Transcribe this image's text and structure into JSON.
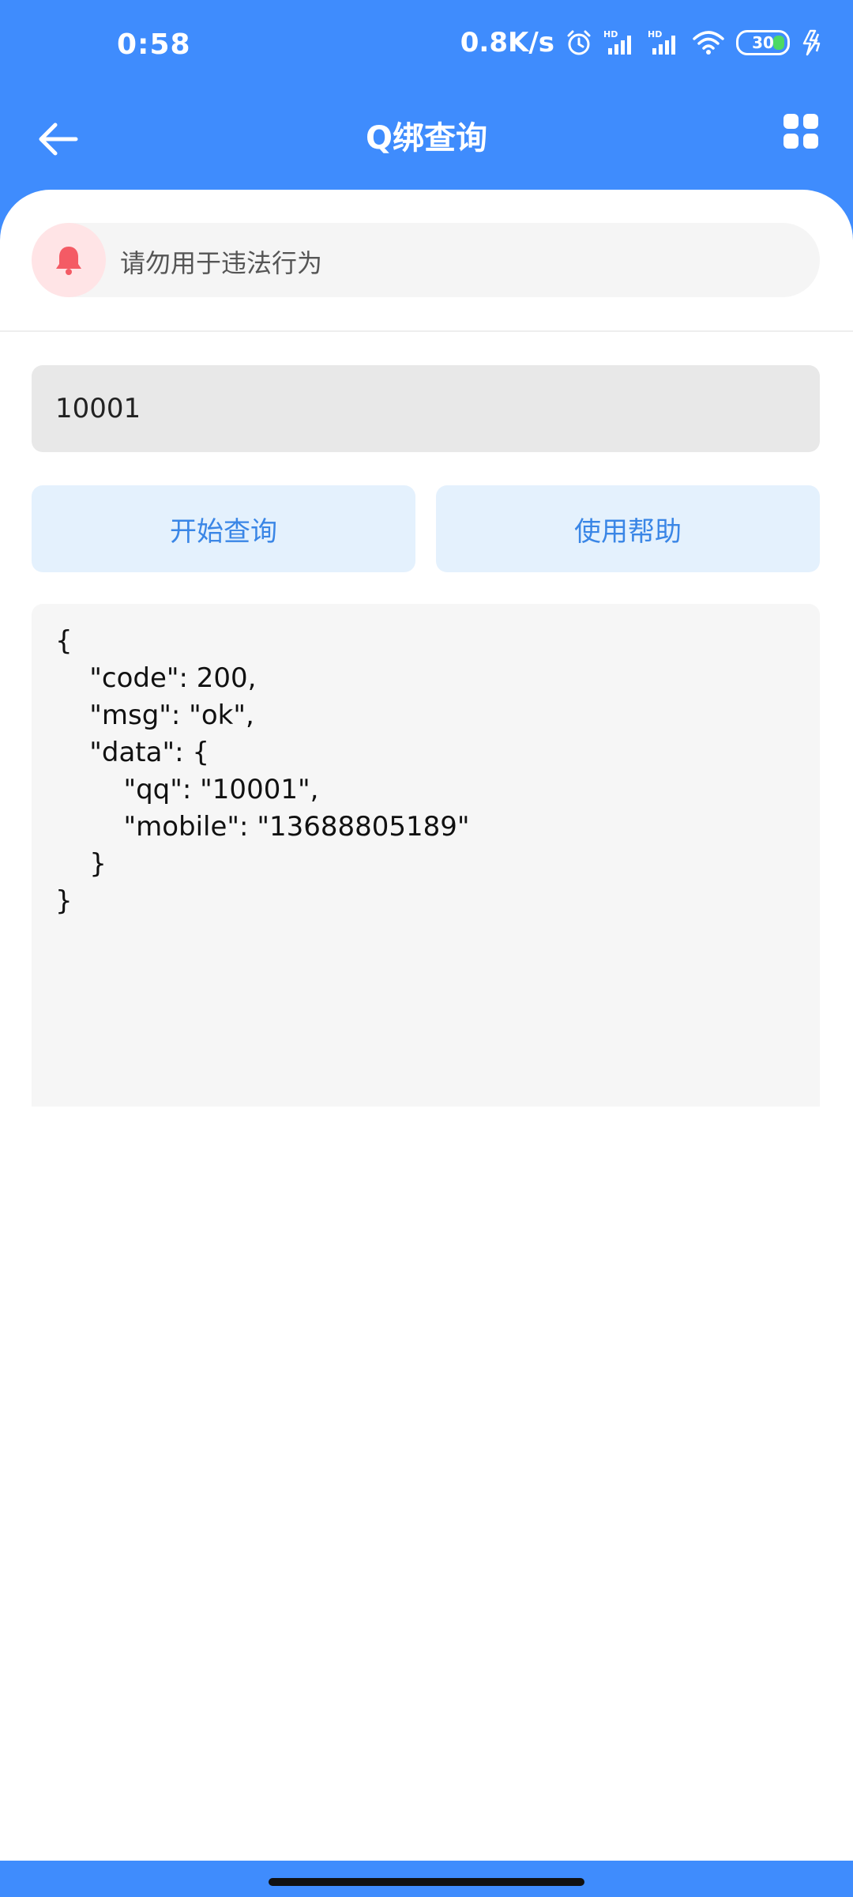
{
  "status_bar": {
    "time": "0:58",
    "network_speed": "0.8K/s",
    "battery_level": "30",
    "icons": [
      "alarm-icon",
      "signal-hd-icon",
      "signal-hd-icon",
      "wifi-icon",
      "battery-icon",
      "charging-icon"
    ]
  },
  "app_bar": {
    "title": "Q绑查询",
    "back_icon": "arrow-left-icon",
    "menu_icon": "grid-icon"
  },
  "notice": {
    "icon": "bell-icon",
    "text": "请勿用于违法行为"
  },
  "query_input": {
    "value": "10001"
  },
  "buttons": {
    "query_label": "开始查询",
    "help_label": "使用帮助"
  },
  "result": {
    "text": "{\n    \"code\": 200,\n    \"msg\": \"ok\",\n    \"data\": {\n        \"qq\": \"10001\",\n        \"mobile\": \"13688805189\"\n    }\n}"
  },
  "colors": {
    "primary": "#3f8cfd",
    "button_bg": "#e4f1fd",
    "button_text": "#3a86e6",
    "bell": "#f45b65",
    "bell_bg": "#ffe4e6"
  }
}
